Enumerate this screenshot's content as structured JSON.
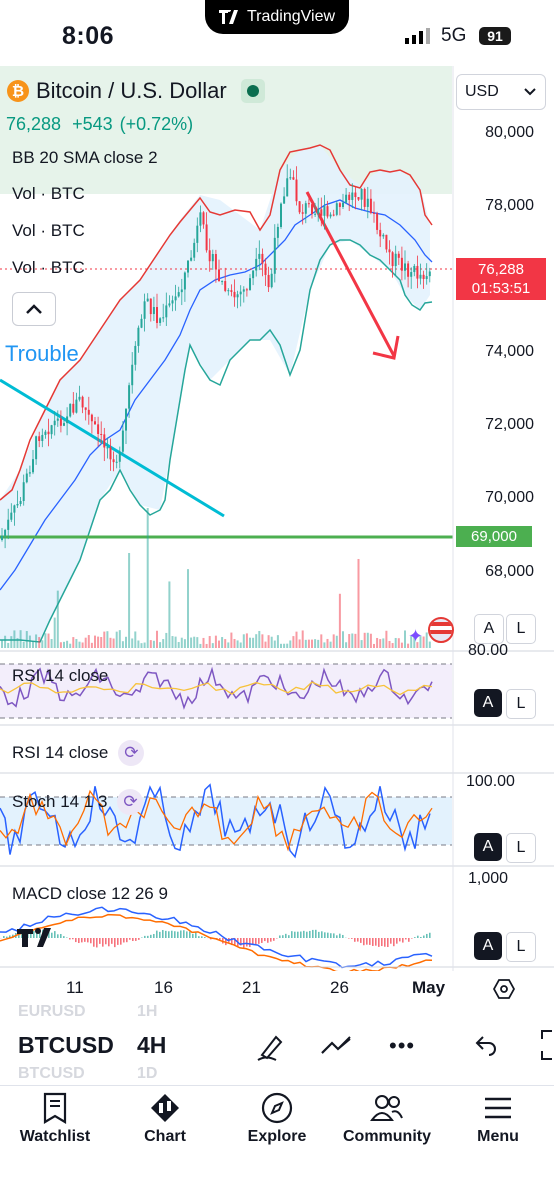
{
  "status_bar": {
    "time": "8:06",
    "network": "5G",
    "battery": "91"
  },
  "brand_pill": {
    "label": "TradingView"
  },
  "symbol": {
    "name": "Bitcoin / U.S. Dollar",
    "price": "76,288",
    "change": "+543",
    "change_pct": "(+0.72%)"
  },
  "currency_button": "USD",
  "indicators": {
    "bb": "BB 20 SMA close 2",
    "vol_1": "Vol · BTC",
    "vol_2": "Vol · BTC",
    "vol_3": "Vol · BTC",
    "rsi_main": "RSI 14 close",
    "rsi_second": "RSI 14 close",
    "stoch": "Stoch 14 1 3",
    "macd": "MACD close 12 26 9"
  },
  "annotation": {
    "trouble": "Trouble"
  },
  "price_scale": [
    "80,000",
    "78,000",
    "74,000",
    "72,000",
    "70,000",
    "68,000"
  ],
  "last_price_tag": {
    "price": "76,288",
    "countdown": "01:53:51",
    "color": "#f23645"
  },
  "level_tag": {
    "price": "69,000",
    "color": "#4caf50"
  },
  "rsi_scale": "80.00",
  "stoch_scale": "100.00",
  "macd_scale": "1,000",
  "scale_buttons": {
    "auto": "A",
    "log": "L"
  },
  "time_axis": [
    "11",
    "16",
    "21",
    "26",
    "May"
  ],
  "toolbar": {
    "symbol": "BTCUSD",
    "interval": "4H",
    "ghost_symbols": [
      "EURUSD",
      "BTCUSD"
    ],
    "ghost_intervals": [
      "1H",
      "1D"
    ]
  },
  "nav": {
    "watchlist": "Watchlist",
    "chart": "Chart",
    "explore": "Explore",
    "community": "Community",
    "menu": "Menu"
  },
  "colors": {
    "up": "#26a69a",
    "down": "#f23645",
    "bb_fill": "#e3f2fd",
    "trend_line": "#00bcd4",
    "support": "#4caf50",
    "forecast_arrow": "#f23645"
  }
}
